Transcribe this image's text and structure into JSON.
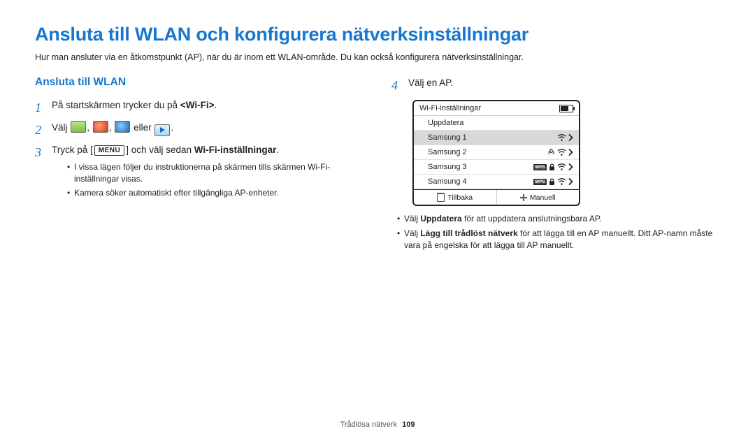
{
  "title": "Ansluta till WLAN och konfigurera nätverksinställningar",
  "intro": "Hur man ansluter via en åtkomstpunkt (AP), när du är inom ett WLAN-område. Du kan också konfigurera nätverksinställningar.",
  "subhead": "Ansluta till WLAN",
  "steps": {
    "s1_pre": "På startskärmen trycker du på ",
    "s1_b": "<Wi-Fi>",
    "s1_post": ".",
    "s2_pre": "Välj ",
    "s2_mid": ", ",
    "s2_or": " eller ",
    "s2_post": ".",
    "s3_pre": "Tryck på [",
    "s3_menu": "MENU",
    "s3_mid": "] och välj sedan ",
    "s3_b": "Wi-Fi-inställningar",
    "s3_post": ".",
    "s3_bullets": [
      "I vissa lägen följer du instruktionerna på skärmen tills skärmen Wi-Fi-inställningar visas.",
      "Kamera söker automatiskt efter tillgängliga AP-enheter."
    ],
    "s4": "Välj en AP."
  },
  "screenshot": {
    "header": "Wi-Fi-inställningar",
    "rows": [
      {
        "label": "Uppdatera",
        "wps": false,
        "lock": false,
        "wifi": false,
        "arrow": false
      },
      {
        "label": "Samsung 1",
        "wps": false,
        "lock": false,
        "wifi": true,
        "arrow": true,
        "selected": true
      },
      {
        "label": "Samsung 2",
        "wps": false,
        "lock": false,
        "wifi": true,
        "arrow": true,
        "adhoc": true
      },
      {
        "label": "Samsung 3",
        "wps": true,
        "lock": true,
        "wifi": true,
        "arrow": true
      },
      {
        "label": "Samsung 4",
        "wps": true,
        "lock": true,
        "wifi": true,
        "arrow": true
      }
    ],
    "footer_left": "Tillbaka",
    "footer_right": "Manuell"
  },
  "post_bullets": {
    "b1_pre": "Välj ",
    "b1_b": "Uppdatera",
    "b1_post": " för att uppdatera anslutningsbara AP.",
    "b2_pre": "Välj ",
    "b2_b": "Lägg till trådlöst nätverk",
    "b2_post": " för att lägga till en AP manuellt. Ditt AP-namn måste vara på engelska för att lägga till AP manuellt."
  },
  "footer_label": "Trådlösa nätverk",
  "footer_page": "109"
}
